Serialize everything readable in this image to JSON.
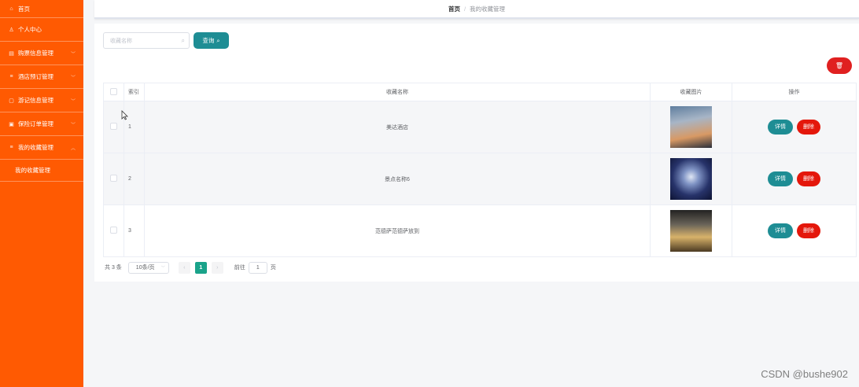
{
  "sidebar": {
    "items": [
      {
        "label": "首页",
        "icon": "home-icon",
        "glyph": "⌂",
        "has_children": false
      },
      {
        "label": "个人中心",
        "icon": "user-icon",
        "glyph": "♙",
        "has_children": false
      },
      {
        "label": "购票信息管理",
        "icon": "ticket-icon",
        "glyph": "▤",
        "has_children": true
      },
      {
        "label": "酒店预订管理",
        "icon": "list-icon",
        "glyph": "≡",
        "has_children": true
      },
      {
        "label": "游记信息管理",
        "icon": "document-icon",
        "glyph": "▢",
        "has_children": true
      },
      {
        "label": "保险订单管理",
        "icon": "file-icon",
        "glyph": "▣",
        "has_children": true
      },
      {
        "label": "我的收藏管理",
        "icon": "list-icon",
        "glyph": "≡",
        "has_children": true
      }
    ],
    "submenu": {
      "label": "我的收藏管理"
    }
  },
  "breadcrumb": {
    "home": "首页",
    "separator": "/",
    "current": "我的收藏管理"
  },
  "search": {
    "placeholder": "收藏名称",
    "button_label": "查询"
  },
  "table": {
    "headers": {
      "index": "索引",
      "name": "收藏名称",
      "image": "收藏图片",
      "actions": "操作"
    },
    "rows": [
      {
        "index": "1",
        "name": "美达酒店",
        "thumb": "hotel-building-photo"
      },
      {
        "index": "2",
        "name": "景点名称6",
        "thumb": "starry-sky-photo"
      },
      {
        "index": "3",
        "name": "范德萨范德萨放到",
        "thumb": "lake-tree-sunset-photo"
      }
    ],
    "detail_label": "详情",
    "delete_label": "删除"
  },
  "pagination": {
    "total_text": "共 3 条",
    "page_size": "10条/页",
    "current_page": "1",
    "goto_label": "前往",
    "goto_value": "1",
    "page_suffix": "页"
  },
  "watermark": "CSDN @bushe902",
  "colors": {
    "sidebar": "#ff5a02",
    "primary": "#1e8d94",
    "danger": "#e4170b",
    "active_page": "#1aa38a"
  }
}
